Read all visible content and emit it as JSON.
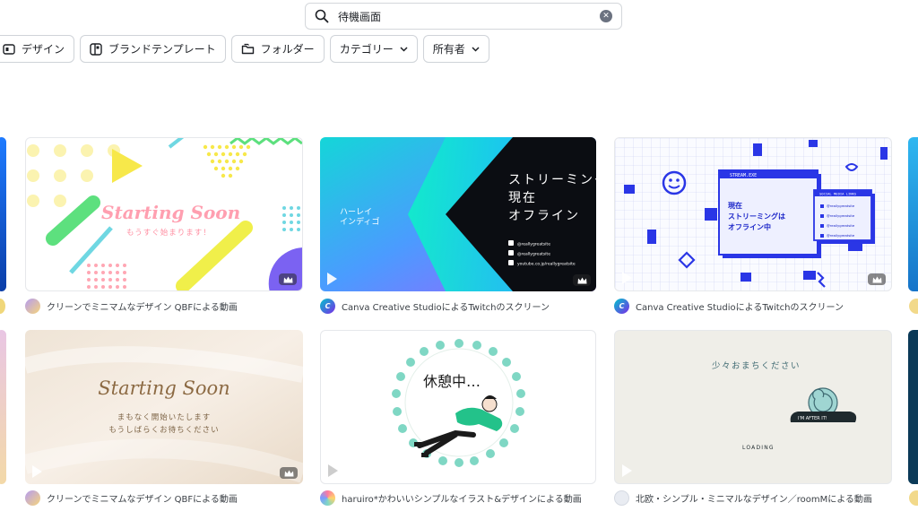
{
  "search": {
    "value": "待機画面"
  },
  "filters": [
    {
      "label": "デザイン"
    },
    {
      "label": "ブランドテンプレート"
    },
    {
      "label": "フォルダー"
    },
    {
      "label": "カテゴリー"
    },
    {
      "label": "所有者"
    }
  ],
  "cards": [
    {
      "caption": "クリーンでミニマムなデザイン QBFによる動画",
      "title": "Starting Soon",
      "subtitle": "もうすぐ始まります！"
    },
    {
      "caption": "Canva Creative StudioによるTwitchのスクリーン",
      "title_line1": "ストリーミング",
      "title_line2": "現在",
      "title_line3": "オフライン",
      "left_text": "ハーレイ\nインディゴ",
      "socials": [
        "@reallygreatsite",
        "@reallygreatsite",
        "youtube.co.jp/reallygreatsite"
      ]
    },
    {
      "caption": "Canva Creative StudioによるTwitchのスクリーン",
      "window_title": "STREAM.EXE",
      "message_line1": "現在",
      "message_line2": "ストリーミングは",
      "message_line3": "オフライン中",
      "panel_title": "SOCIAL MEDIA LINKS",
      "panel_items": [
        "@reallygreatsite",
        "@reallygreatsite",
        "@reallygreatsite",
        "@reallygreatsite"
      ]
    },
    {
      "caption": "クリーンでミニマムなデザイン QBFによる動画",
      "title": "Starting Soon",
      "line1": "まもなく開始いたします",
      "line2": "もうしばらくお待ちください"
    },
    {
      "caption": "haruiro*かわいいシンプルなイラスト&デザインによる動画",
      "title": "休憩中…"
    },
    {
      "caption": "北欧・シンプル・ミニマルなデザイン／roomMによる動画",
      "title": "少々おまちください",
      "badge": "I'M AFTER IT!",
      "loading": "LOADING"
    }
  ],
  "colors": {
    "canva_teal": "#00c4cc",
    "canva_purple": "#7d2ae8"
  }
}
